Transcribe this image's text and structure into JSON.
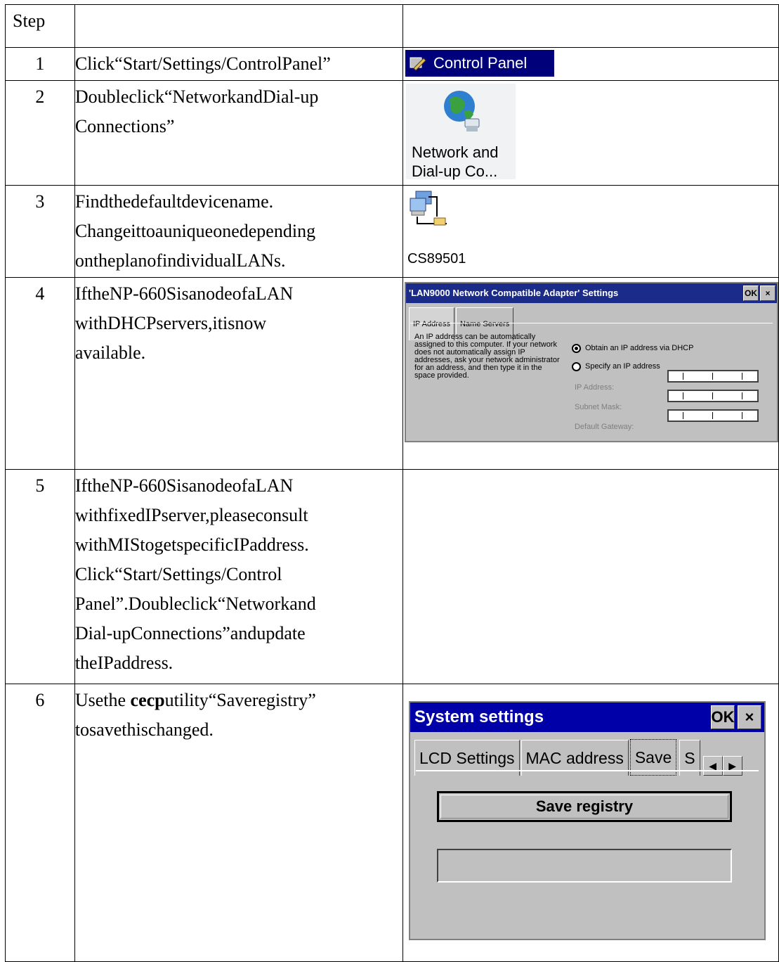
{
  "header": {
    "step_label": "Step",
    "col2": "",
    "col3": ""
  },
  "rows": [
    {
      "num": "1",
      "lines": [
        "Click“Start/Settings/ControlPanel”"
      ]
    },
    {
      "num": "2",
      "lines": [
        "Doubleclick“NetworkandDial-up",
        "Connections”"
      ]
    },
    {
      "num": "3",
      "lines": [
        "Findthedefaultdevicename.",
        "Changeittoauniqueonedepending",
        "ontheplanofindividualLANs."
      ]
    },
    {
      "num": "4",
      "lines": [
        "IftheNP-660SisanodeofaLAN",
        "withDHCPservers,itisnow",
        "available."
      ]
    },
    {
      "num": "5",
      "lines": [
        "IftheNP-660SisanodeofaLAN",
        "withfixedIPserver,pleaseconsult",
        "withMIStogetspecificIPaddress.",
        "Click“Start/Settings/Control",
        "Panel”.Doubleclick“Networkand",
        "Dial-upConnections”andupdate",
        "theIPaddress."
      ]
    },
    {
      "num": "6",
      "line1_pre": "Usethe ",
      "line1_bold": "cecp",
      "line1_post": "utility“Saveregistry”",
      "line2": "tosavethischanged."
    }
  ],
  "control_panel": {
    "label": "Control Panel"
  },
  "network_icon": {
    "line1": "Network and",
    "line2": "Dial-up Co..."
  },
  "device": {
    "name": "CS89501"
  },
  "adapter_dialog": {
    "title": "'LAN9000 Network Compatible Adapter' Settings",
    "ok": "OK",
    "close": "×",
    "tabs": [
      "IP Address",
      "Name Servers"
    ],
    "info": "An IP address can be automatically assigned to this computer.  If your network does not automatically assign IP addresses, ask your network administrator for an address, and then type it in the space provided.",
    "option_dhcp": "Obtain an IP address via DHCP",
    "option_specify": "Specify an IP address",
    "field_ip": "IP Address:",
    "field_mask": "Subnet Mask:",
    "field_gateway": "Default Gateway:"
  },
  "system_dialog": {
    "title": "System settings",
    "ok": "OK",
    "close": "×",
    "tabs": [
      "LCD Settings",
      "MAC address",
      "Save",
      "S"
    ],
    "save_button": "Save registry",
    "status": ""
  }
}
